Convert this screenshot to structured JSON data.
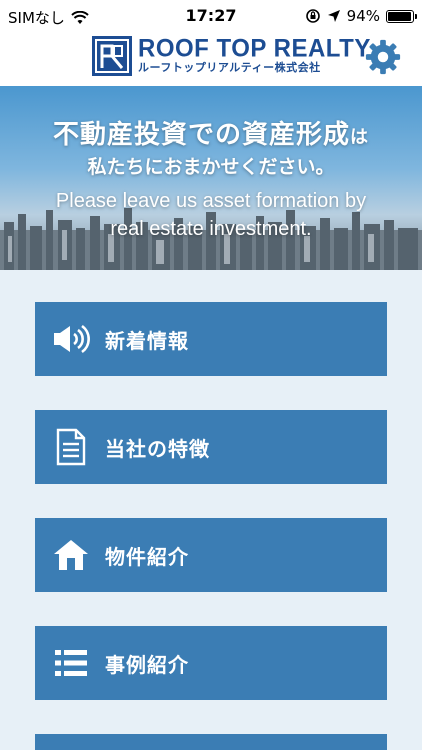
{
  "status_bar": {
    "carrier": "SIMなし",
    "time": "17:27",
    "battery": "94%",
    "battery_level": 0.94
  },
  "header": {
    "logo_main": "ROOF TOP REALTY",
    "logo_sub": "ルーフトップリアルティー株式会社",
    "settings_icon": "gear-icon"
  },
  "hero": {
    "jp_line1": "不動産投資での資産形成",
    "jp_line1_suffix": "は",
    "jp_line2": "私たちにおまかせください。",
    "en_line1": "Please leave us asset formation by",
    "en_line2": "real estate investment."
  },
  "menu": {
    "items": [
      {
        "label": "新着情報",
        "icon": "megaphone-icon"
      },
      {
        "label": "当社の特徴",
        "icon": "document-icon"
      },
      {
        "label": "物件紹介",
        "icon": "house-icon"
      },
      {
        "label": "事例紹介",
        "icon": "list-icon"
      }
    ]
  },
  "colors": {
    "brand": "#1d4d93",
    "menu_button": "#3b7db4",
    "menu_background": "#e7f0f7"
  }
}
